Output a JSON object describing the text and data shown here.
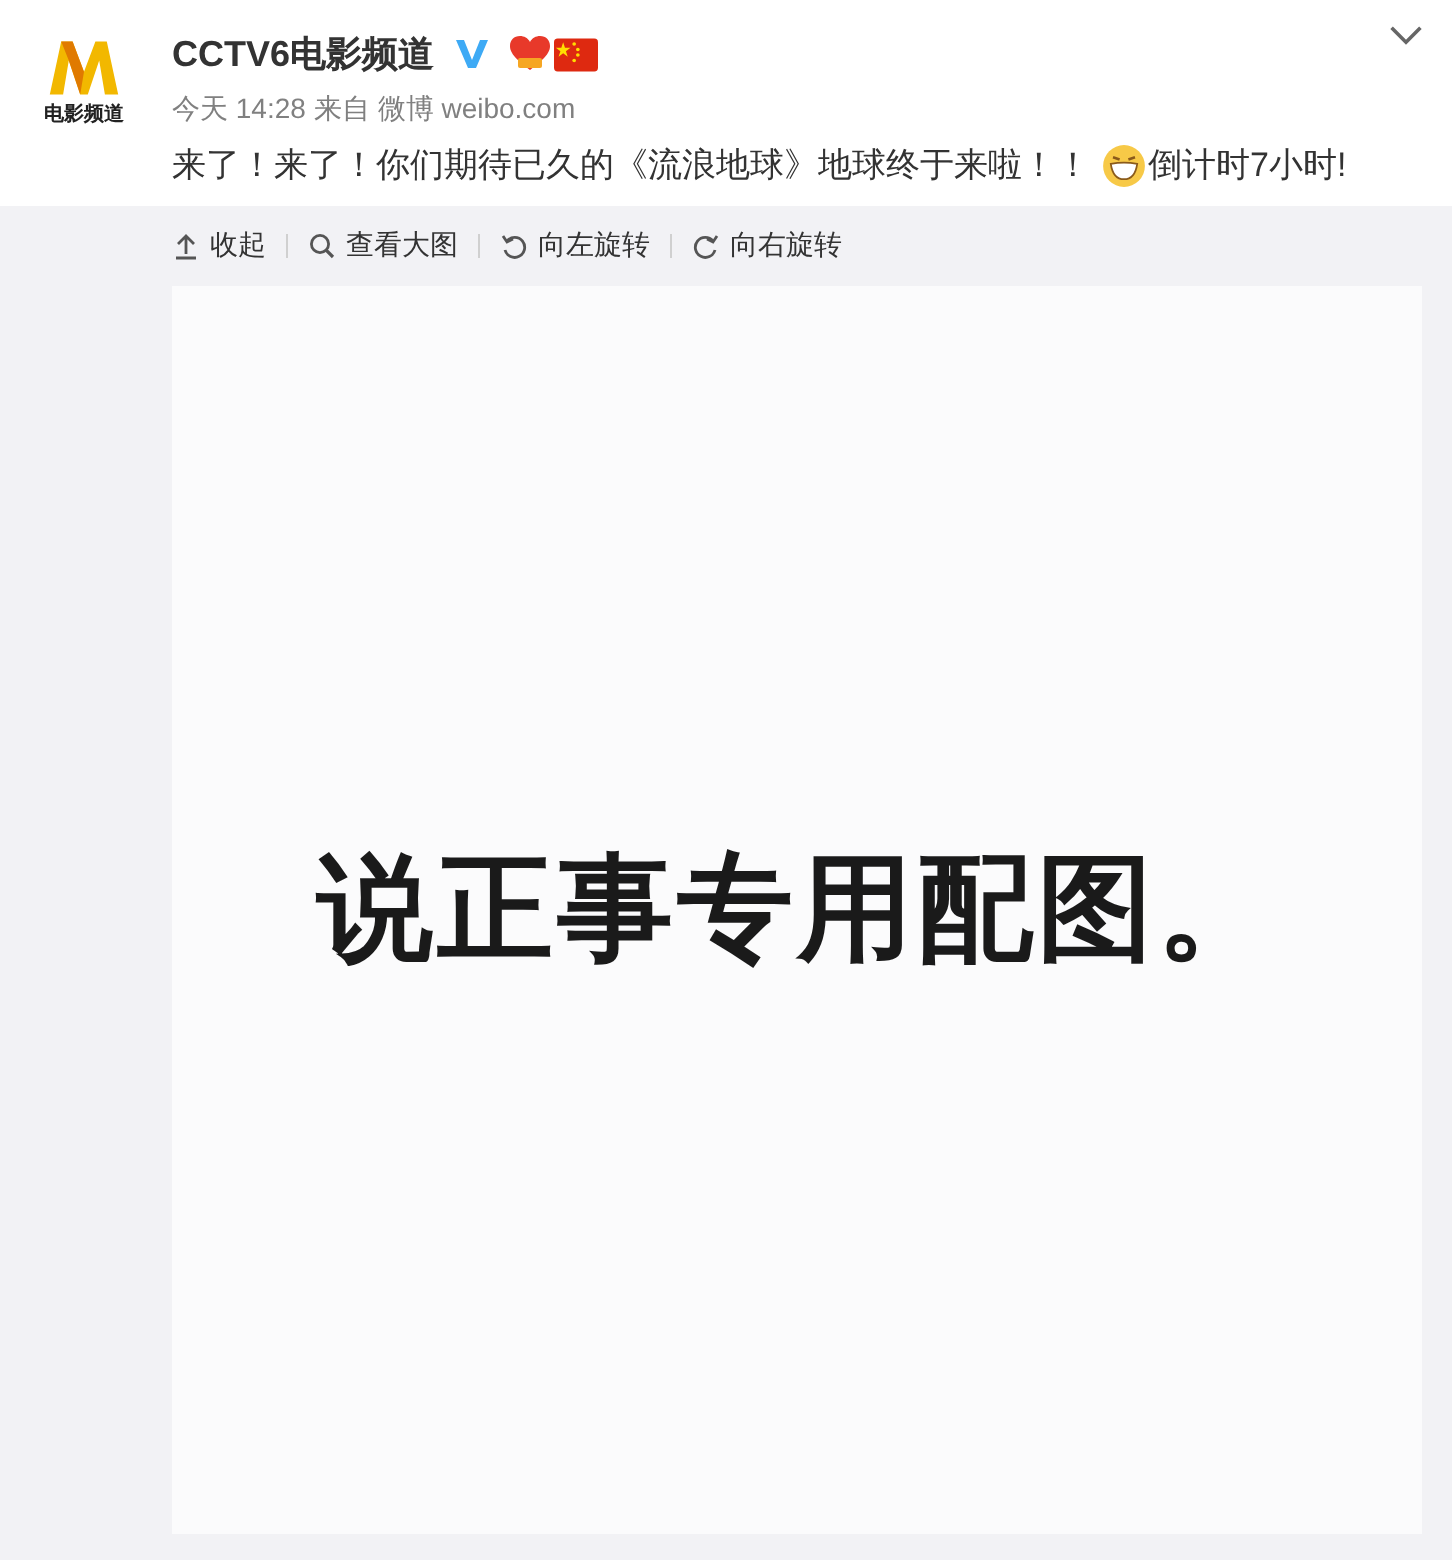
{
  "logo": {
    "caption": "电影频道"
  },
  "post": {
    "author": "CCTV6电影频道",
    "verified": true,
    "time": "今天 14:28",
    "source_prefix": "来自",
    "source": "微博 weibo.com",
    "text_parts": [
      {
        "kind": "text",
        "text": "来了！来了！你们期待已久的《流浪地球》地球终于来啦！！"
      },
      {
        "kind": "emoji"
      },
      {
        "kind": "text",
        "text": "倒计时7小时!"
      }
    ]
  },
  "toolbar": [
    {
      "kind": "collapse",
      "label": "收起"
    },
    {
      "kind": "zoom",
      "label": "查看大图"
    },
    {
      "kind": "rotate_left",
      "label": "向左旋转"
    },
    {
      "kind": "rotate_right",
      "label": "向右旋转"
    }
  ],
  "image": {
    "text": "说正事专用配图。"
  }
}
